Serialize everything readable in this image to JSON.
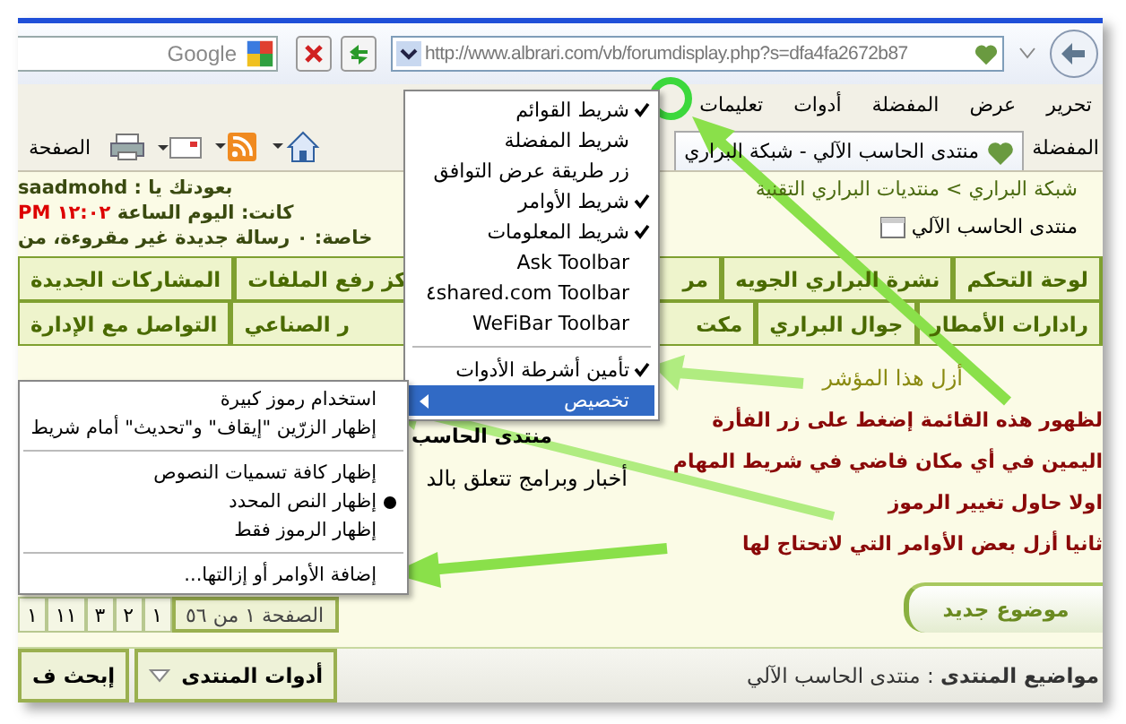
{
  "toolbar": {
    "search_placeholder": "Google",
    "address": "http://www.albrari.com/vb/forumdisplay.php?s=dfa4fa2672b87"
  },
  "menu_bar": [
    "تحرير",
    "عرض",
    "المفضلة",
    "أدوات",
    "تعليمات"
  ],
  "favorites_bar": {
    "label": "المفضلة",
    "tab": "منتدى الحاسب الآلي - شبكة البراري",
    "page_button": "الصفحة"
  },
  "page": {
    "breadcrumb": "شبكة البراري > منتديات البراري التقنية",
    "forum_link": "منتدى الحاسب الآلي",
    "welcome": "بعودتك يا : saadmohd",
    "last_visit": "كانت: اليوم الساعة",
    "last_visit_time": "١٢:٠٢ PM",
    "messages": "خاصة: ٠ رسالة جديدة غير مقروءة، من",
    "nav_rows": [
      [
        {
          "kind": "full",
          "label": "لوحة التحكم"
        },
        {
          "kind": "full",
          "label": "نشرة البراري الجويه"
        },
        {
          "kind": "cut_end",
          "label": "مر"
        },
        {
          "kind": "cut_start",
          "label": "كز رفع الملفات"
        },
        {
          "kind": "full",
          "label": "المشاركات الجديدة"
        }
      ],
      [
        {
          "kind": "full",
          "label": "رادارات الأمطار"
        },
        {
          "kind": "full",
          "label": "جوال البراري"
        },
        {
          "kind": "cut_end",
          "label": "مكت"
        },
        {
          "kind": "cut_start",
          "label": "ر الصناعي"
        },
        {
          "kind": "full",
          "label": "التواصل مع الإدارة"
        }
      ]
    ],
    "forum_heading": "منتدى الحاسب",
    "forum_description": "أخبار وبرامج تتعلق بالد",
    "new_topic": "موضوع جديد",
    "pagination": {
      "label": "الصفحة ١ من ٥٦",
      "pages": [
        "١",
        "٢",
        "٣",
        "١١",
        "١"
      ]
    },
    "footer": {
      "title": "مواضيع المنتدى",
      "forum": ": منتدى الحاسب الآلي",
      "tools": "أدوات المنتدى",
      "search": "إبحث ف"
    }
  },
  "context_menu": [
    {
      "kind": "toggle",
      "label": "شريط القوائم",
      "checked": true,
      "selected": false
    },
    {
      "kind": "toggle",
      "label": "شريط المفضلة",
      "checked": false,
      "selected": false
    },
    {
      "kind": "toggle",
      "label": "زر طريقة عرض التوافق",
      "checked": false,
      "selected": false
    },
    {
      "kind": "toggle",
      "label": "شريط الأوامر",
      "checked": true,
      "selected": false
    },
    {
      "kind": "toggle",
      "label": "شريط المعلومات",
      "checked": true,
      "selected": false
    },
    {
      "kind": "toggle",
      "label": "Ask Toolbar",
      "checked": false,
      "selected": false
    },
    {
      "kind": "toggle",
      "label": "٤shared.com Toolbar",
      "checked": false,
      "selected": false
    },
    {
      "kind": "toggle",
      "label": "WeFiBar Toolbar",
      "checked": false,
      "selected": false
    },
    {
      "kind": "separator"
    },
    {
      "kind": "toggle",
      "label": "تأمين أشرطة الأدوات",
      "checked": true,
      "selected": false
    },
    {
      "kind": "submenu",
      "label": "تخصيص",
      "selected": true
    }
  ],
  "submenu": [
    {
      "kind": "toggle",
      "label": "استخدام رموز كبيرة",
      "checked": false
    },
    {
      "kind": "toggle",
      "label": "إظهار الزرّين \"إيقاف\" و\"تحديث\" أمام شريط",
      "checked": false
    },
    {
      "kind": "separator"
    },
    {
      "kind": "radio",
      "label": "إظهار كافة تسميات النصوص",
      "selected": false
    },
    {
      "kind": "radio",
      "label": "إظهار النص المحدد",
      "selected": true
    },
    {
      "kind": "radio",
      "label": "إظهار الرموز فقط",
      "selected": false
    },
    {
      "kind": "separator"
    },
    {
      "kind": "command",
      "label": "إضافة الأوامر أو إزالتها..."
    }
  ],
  "annotations": [
    {
      "kind": "hint",
      "text": "أزل هذا المؤشر"
    },
    {
      "kind": "note",
      "text": "لظهور هذه القائمة إضغط على زر الفأرة"
    },
    {
      "kind": "note",
      "text": "اليمين في أي مكان فاضي في شريط المهام"
    },
    {
      "kind": "note",
      "text": "اولا حاول تغيير الرموز"
    },
    {
      "kind": "note",
      "text": "ثانيا أزل بعض الأوامر التي لاتحتاج لها"
    }
  ]
}
